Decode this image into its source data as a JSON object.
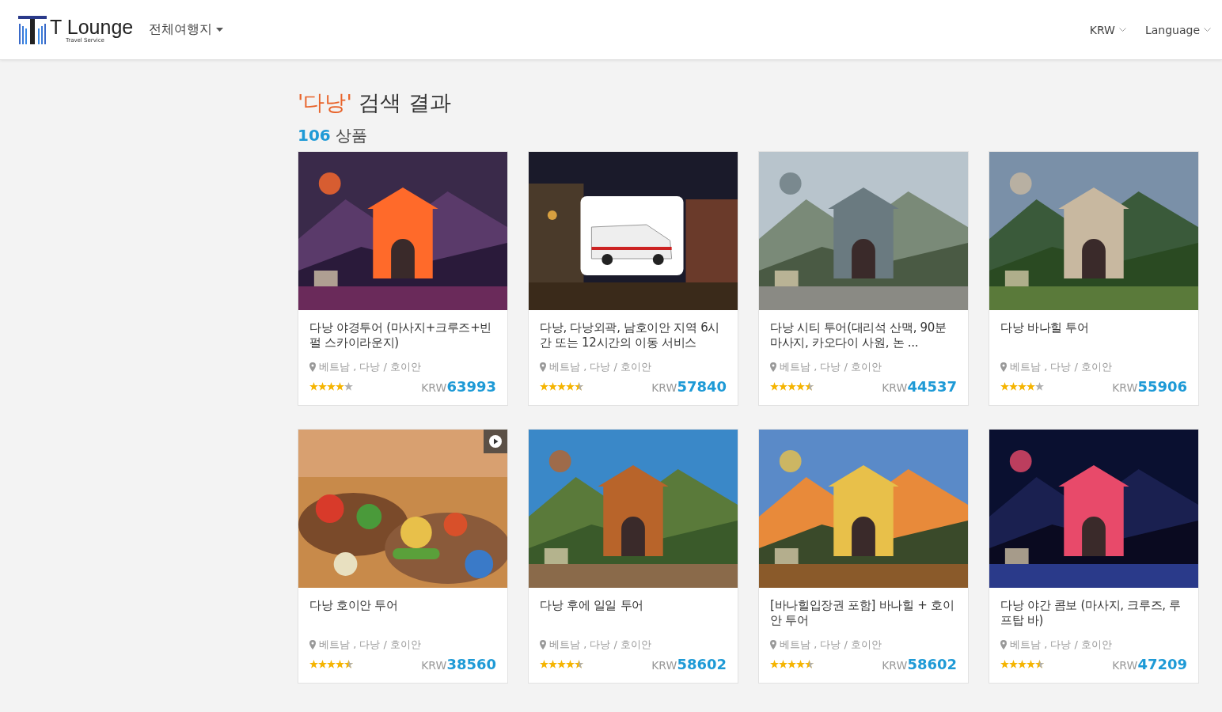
{
  "header": {
    "logo": {
      "name": "T Lounge",
      "tagline": "Travel Service"
    },
    "destination_menu": "전체여행지",
    "currency": "KRW",
    "language": "Language"
  },
  "search": {
    "query": "'다낭'",
    "title_rest": " 검색 결과",
    "count": "106",
    "count_unit": "상품"
  },
  "products": [
    {
      "title": "다낭 야경투어 (마사지+크루즈+빈펄 스카이라운지)",
      "location": "베트남 , 다낭 / 호이안",
      "stars": 4,
      "currency": "KRW",
      "price": "63993",
      "video": false
    },
    {
      "title": "다낭, 다낭외곽, 남호이안 지역 6시간 또는 12시간의 이동 서비스",
      "location": "베트남 , 다낭 / 호이안",
      "stars": 4.5,
      "currency": "KRW",
      "price": "57840",
      "video": false
    },
    {
      "title": "다낭 시티 투어(대리석 산맥, 90분 마사지, 카오다이 사원, 논 ...",
      "location": "베트남 , 다낭 / 호이안",
      "stars": 4.5,
      "currency": "KRW",
      "price": "44537",
      "video": false
    },
    {
      "title": "다낭 바나힐 투어",
      "location": "베트남 , 다낭 / 호이안",
      "stars": 4,
      "currency": "KRW",
      "price": "55906",
      "video": false
    },
    {
      "title": "다낭 호이안 투어",
      "location": "베트남 , 다낭 / 호이안",
      "stars": 4.5,
      "currency": "KRW",
      "price": "38560",
      "video": true
    },
    {
      "title": "다낭 후에 일일 투어",
      "location": "베트남 , 다낭 / 호이안",
      "stars": 4.5,
      "currency": "KRW",
      "price": "58602",
      "video": false
    },
    {
      "title": "[바나힐입장권 포함] 바나힐 + 호이안 투어",
      "location": "베트남 , 다낭 / 호이안",
      "stars": 4.5,
      "currency": "KRW",
      "price": "58602",
      "video": false
    },
    {
      "title": "다낭 야간 콤보 (마사지, 크루즈, 루프탑 바)",
      "location": "베트남 , 다낭 / 호이안",
      "stars": 4.5,
      "currency": "KRW",
      "price": "47209",
      "video": false
    }
  ]
}
